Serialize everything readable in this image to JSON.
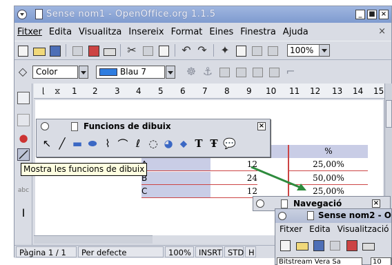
{
  "window": {
    "title": "Sense nom1 - OpenOffice.org 1.1.5",
    "buttons": {
      "minimize": "_",
      "maximize": "■",
      "close": "×"
    }
  },
  "menubar": {
    "items": [
      "Fitxer",
      "Edita",
      "Visualitza",
      "Insereix",
      "Format",
      "Eines",
      "Finestra",
      "Ajuda"
    ],
    "close": "×"
  },
  "toolbar": {
    "zoom": "100%"
  },
  "formatbar": {
    "line_style": "Color",
    "fill_color": "Blau 7",
    "fill_color_hex": "#2f7de0"
  },
  "ruler": {
    "numbers": [
      "1",
      "2",
      "3",
      "4",
      "5",
      "6",
      "7",
      "8",
      "9",
      "10",
      "11",
      "12",
      "13",
      "14",
      "15"
    ]
  },
  "table": {
    "header": [
      "",
      "",
      "%"
    ],
    "rows": [
      [
        "A",
        "12",
        "25,00%"
      ],
      [
        "B",
        "24",
        "50,00%"
      ],
      [
        "C",
        "12",
        "25,00%"
      ]
    ]
  },
  "draw_panel": {
    "title": "Funcions de dibuix",
    "tools": [
      "select-arrow-icon",
      "line-icon",
      "rectangle-icon",
      "ellipse-icon",
      "polygon-icon",
      "curve-icon",
      "freeform-icon",
      "arc-icon",
      "pie-icon",
      "drop-icon",
      "text-icon",
      "fontwork-icon",
      "callout-icon"
    ]
  },
  "tooltip": "Mostra les funcions de dibuix",
  "statusbar": {
    "page": "Pàgina 1 / 1",
    "style": "Per defecte",
    "zoom": "100%",
    "insert": "INSRT",
    "std": "STD",
    "extra": "H"
  },
  "navigator": {
    "title": "Navegació"
  },
  "second_window": {
    "title": "Sense nom2 - O",
    "menu": [
      "Fitxer",
      "Edita",
      "Visualització"
    ],
    "font": "Bitstream Vera Sa",
    "size": "10"
  },
  "colors": {
    "accent": "#2f7de0",
    "title_bar": "#7f9bcf",
    "arrow": "#2e8b3d",
    "table_header": "#c9cde6"
  }
}
